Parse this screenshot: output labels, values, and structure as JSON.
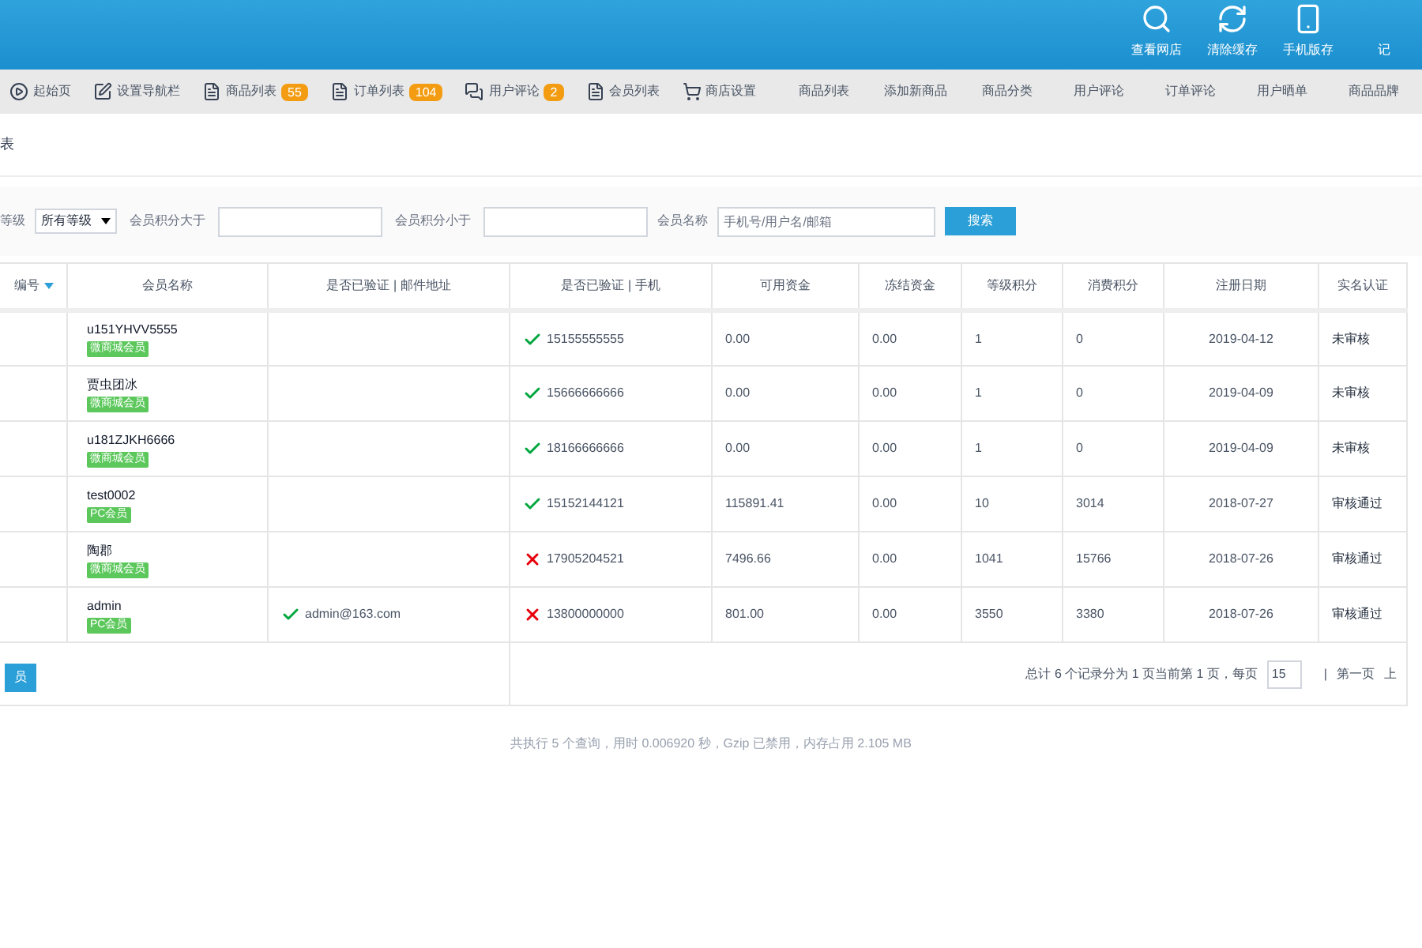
{
  "header": {
    "actions": [
      {
        "label": "查看网店",
        "kind": "search"
      },
      {
        "label": "清除缓存",
        "kind": "refresh"
      },
      {
        "label": "手机版存",
        "kind": "phone"
      },
      {
        "label": "记",
        "kind": "none"
      }
    ]
  },
  "nav": {
    "items": [
      {
        "label": "起始页",
        "kind": "play"
      },
      {
        "label": "设置导航栏",
        "kind": "edit"
      },
      {
        "label": "商品列表",
        "kind": "doc",
        "badge": "55"
      },
      {
        "label": "订单列表",
        "kind": "doc",
        "badge": "104"
      },
      {
        "label": "用户评论",
        "kind": "chat",
        "badge": "2"
      },
      {
        "label": "会员列表",
        "kind": "doc"
      },
      {
        "label": "商店设置",
        "kind": "cart"
      },
      {
        "label": "商品列表",
        "kind": "plain"
      },
      {
        "label": "添加新商品",
        "kind": "plain"
      },
      {
        "label": "商品分类",
        "kind": "plain"
      },
      {
        "label": "用户评论",
        "kind": "plain"
      },
      {
        "label": "订单评论",
        "kind": "plain"
      },
      {
        "label": "用户晒单",
        "kind": "plain"
      },
      {
        "label": "商品品牌",
        "kind": "plain"
      }
    ]
  },
  "page_title": "表",
  "filter": {
    "level_label": "等级",
    "level_select": "所有等级",
    "min_label": "会员积分大于",
    "max_label": "会员积分小于",
    "name_label": "会员名称",
    "name_placeholder": "手机号/用户名/邮箱",
    "search_button": "搜索"
  },
  "table": {
    "columns": [
      "编号",
      "会员名称",
      "是否已验证 | 邮件地址",
      "是否已验证 | 手机",
      "可用资金",
      "冻结资金",
      "等级积分",
      "消费积分",
      "注册日期",
      "实名认证"
    ],
    "rows": [
      {
        "name": "u151YHVV5555",
        "tag": "微商城会员",
        "phone": "15155555555",
        "phone_verified": true,
        "funds": "0.00",
        "frozen": "0.00",
        "rank_points": "1",
        "pay_points": "0",
        "date": "2019-04-12",
        "real_name": "未审核"
      },
      {
        "name": "贾虫团冰",
        "tag": "微商城会员",
        "phone": "15666666666",
        "phone_verified": true,
        "funds": "0.00",
        "frozen": "0.00",
        "rank_points": "1",
        "pay_points": "0",
        "date": "2019-04-09",
        "real_name": "未审核"
      },
      {
        "name": "u181ZJKH6666",
        "tag": "微商城会员",
        "phone": "18166666666",
        "phone_verified": true,
        "funds": "0.00",
        "frozen": "0.00",
        "rank_points": "1",
        "pay_points": "0",
        "date": "2019-04-09",
        "real_name": "未审核"
      },
      {
        "name": "test0002",
        "tag": "PC会员",
        "phone": "15152144121",
        "phone_verified": true,
        "funds": "115891.41",
        "frozen": "0.00",
        "rank_points": "10",
        "pay_points": "3014",
        "date": "2018-07-27",
        "real_name": "审核通过"
      },
      {
        "name": "陶郡",
        "tag": "微商城会员",
        "phone": "17905204521",
        "phone_verified": false,
        "funds": "7496.66",
        "frozen": "0.00",
        "rank_points": "1041",
        "pay_points": "15766",
        "date": "2018-07-26",
        "real_name": "审核通过"
      },
      {
        "name": "admin",
        "tag": "PC会员",
        "email": "admin@163.com",
        "email_verified": true,
        "phone": "13800000000",
        "phone_verified": false,
        "funds": "801.00",
        "frozen": "0.00",
        "rank_points": "3550",
        "pay_points": "3380",
        "date": "2018-07-26",
        "real_name": "审核通过"
      }
    ]
  },
  "footer": {
    "button": "员",
    "pager_text": "总计 6 个记录分为 1 页当前第 1 页，每页",
    "page_size": "15",
    "separator": "|",
    "first": "第一页",
    "prev": "上"
  },
  "status": "共执行 5 个查询，用时 0.006920 秒，Gzip 已禁用，内存占用 2.105 MB"
}
